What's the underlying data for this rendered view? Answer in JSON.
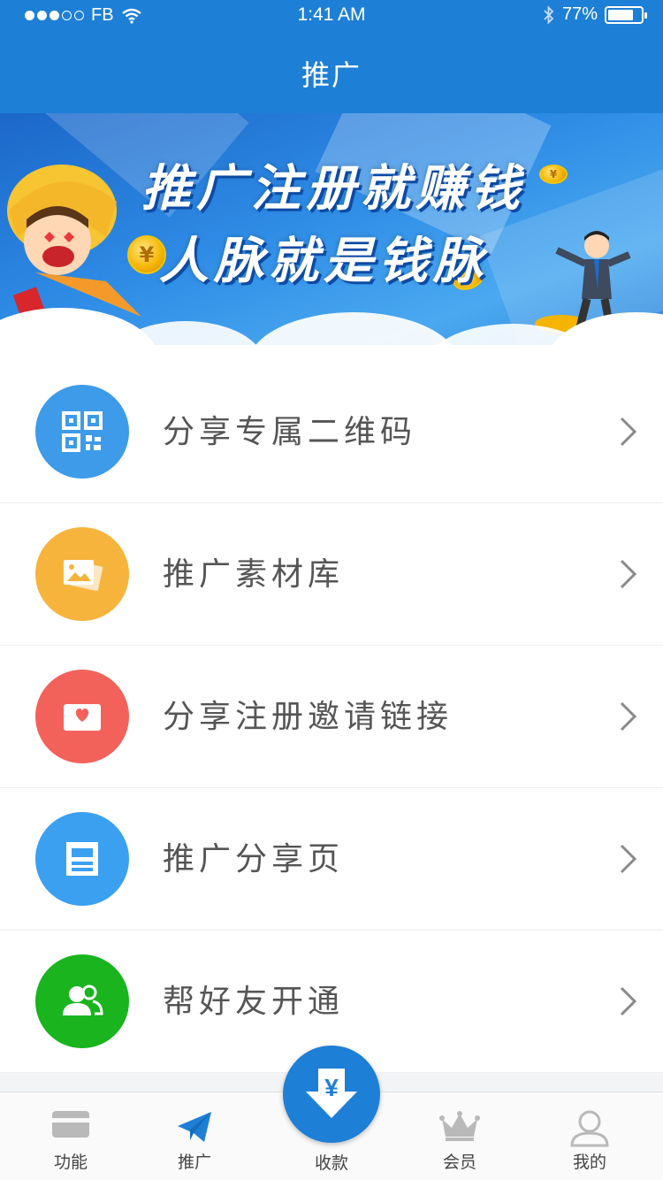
{
  "status_bar": {
    "carrier": "FB",
    "time": "1:41 AM",
    "battery": "77%",
    "battery_level": 0.77
  },
  "nav": {
    "title": "推广"
  },
  "banner": {
    "line1": "推广注册就赚钱",
    "line2": "人脉就是钱脉",
    "coin_symbol": "¥"
  },
  "menu": {
    "items": [
      {
        "label": "分享专属二维码",
        "icon": "qr-code-icon",
        "color": "#3d9be9"
      },
      {
        "label": "推广素材库",
        "icon": "image-gallery-icon",
        "color": "#f6b43c"
      },
      {
        "label": "分享注册邀请链接",
        "icon": "envelope-heart-icon",
        "color": "#f2625a"
      },
      {
        "label": "推广分享页",
        "icon": "page-icon",
        "color": "#3ba0f0"
      },
      {
        "label": "帮好友开通",
        "icon": "users-icon",
        "color": "#19b41e"
      }
    ]
  },
  "tabbar": {
    "tabs": [
      {
        "label": "功能",
        "icon": "card-icon"
      },
      {
        "label": "推广",
        "icon": "paper-plane-icon"
      },
      {
        "label": "收款",
        "icon": "yen-download-icon"
      },
      {
        "label": "会员",
        "icon": "crown-icon"
      },
      {
        "label": "我的",
        "icon": "profile-icon"
      }
    ],
    "active_color": "#1e7fd6"
  }
}
